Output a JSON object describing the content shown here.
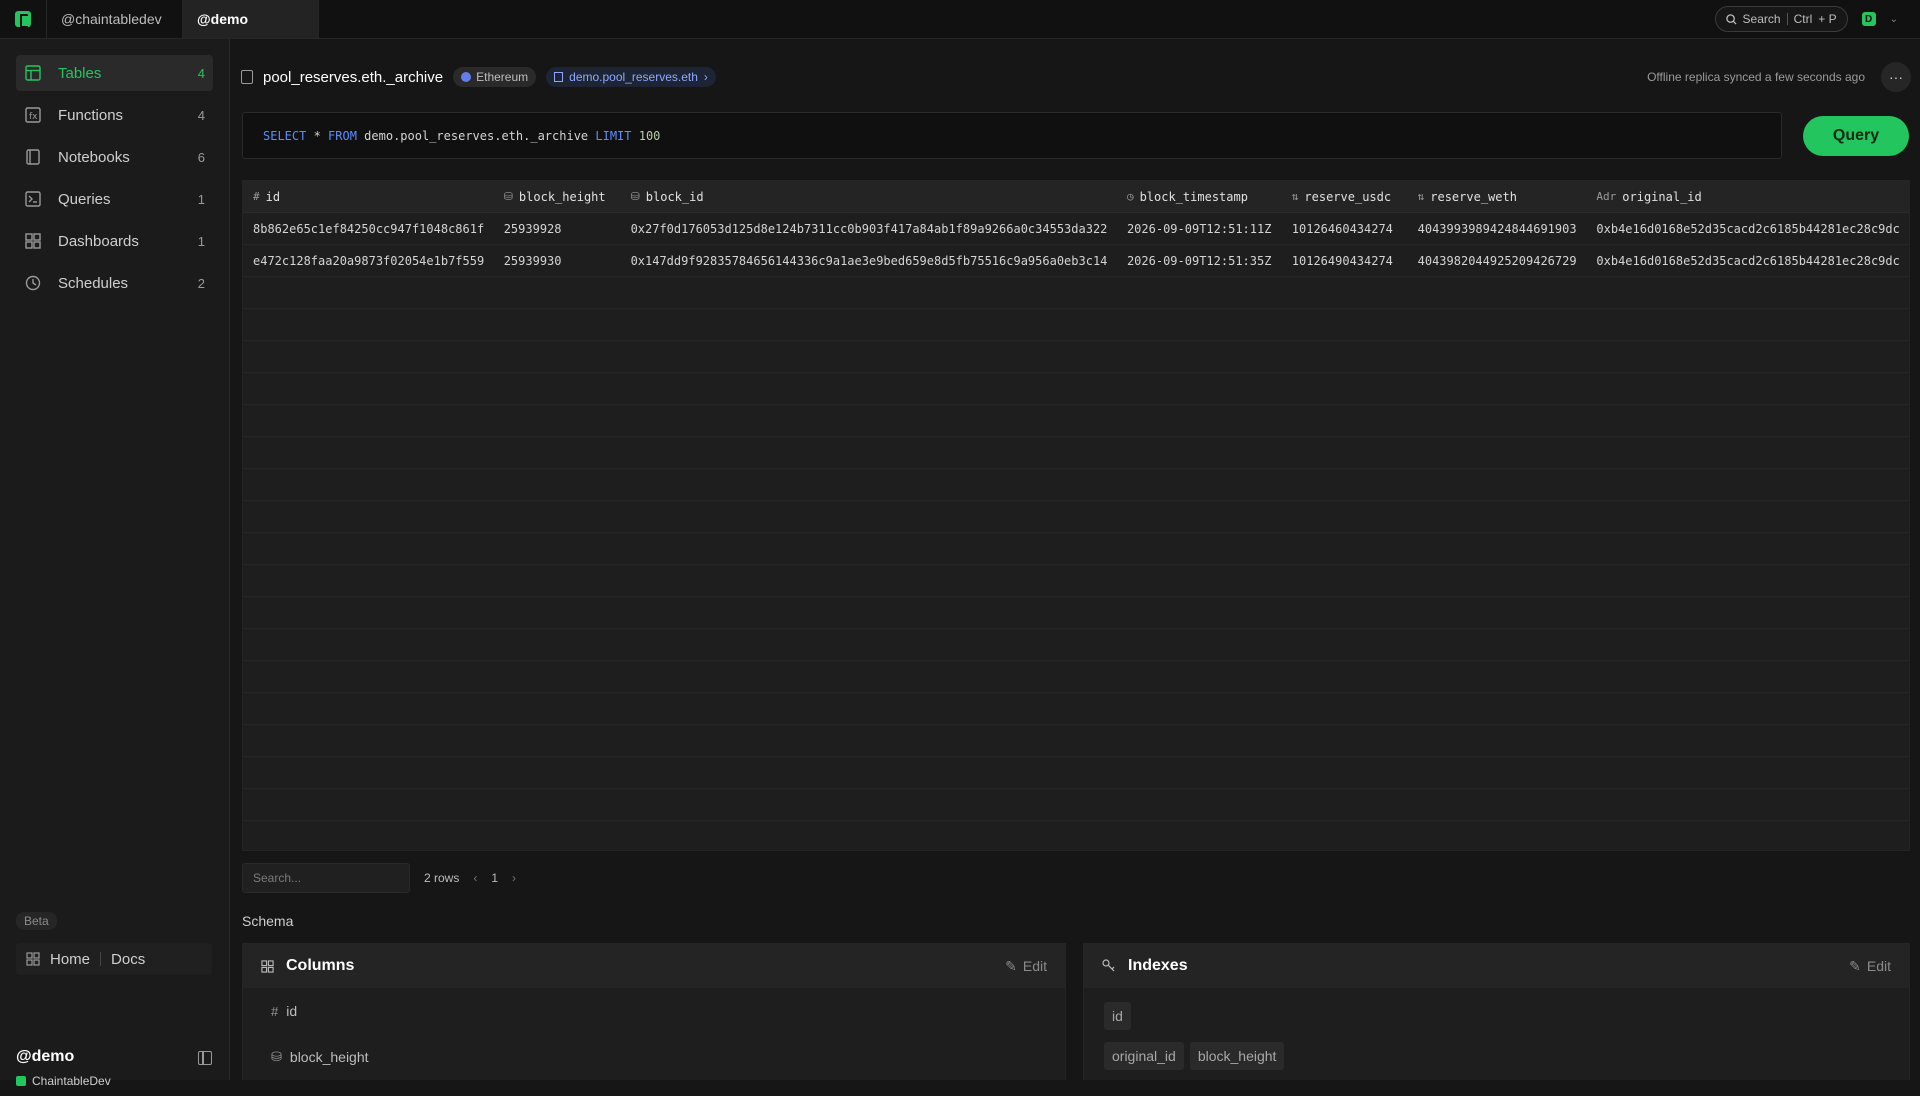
{
  "topbar": {
    "tabs": [
      {
        "label": "@chaintabledev"
      },
      {
        "label": "@demo"
      }
    ],
    "search_label": "Search",
    "shortcut_ctrl": "Ctrl",
    "shortcut_key": "+ P",
    "avatar_letter": "D"
  },
  "sidebar": {
    "items": [
      {
        "label": "Tables",
        "count": "4",
        "icon": "table-icon"
      },
      {
        "label": "Functions",
        "count": "4",
        "icon": "function-icon"
      },
      {
        "label": "Notebooks",
        "count": "6",
        "icon": "notebook-icon"
      },
      {
        "label": "Queries",
        "count": "1",
        "icon": "terminal-icon"
      },
      {
        "label": "Dashboards",
        "count": "1",
        "icon": "dashboard-icon"
      },
      {
        "label": "Schedules",
        "count": "2",
        "icon": "clock-icon"
      }
    ],
    "beta_label": "Beta",
    "home_label": "Home",
    "docs_label": "Docs",
    "user_name": "@demo",
    "org_name": "ChaintableDev"
  },
  "header": {
    "table_name": "pool_reserves.eth._archive",
    "chain_label": "Ethereum",
    "link_label": "demo.pool_reserves.eth",
    "sync_status": "Offline replica synced a few seconds ago",
    "more_label": "···"
  },
  "query": {
    "kw_select": "SELECT",
    "star": " * ",
    "kw_from": "FROM",
    "table": " demo.pool_reserves.eth._archive ",
    "kw_limit": "LIMIT",
    "limit_value": " 100",
    "button_label": "Query"
  },
  "grid": {
    "columns": [
      {
        "name": "id",
        "icon": "#"
      },
      {
        "name": "block_height",
        "icon": "⛁"
      },
      {
        "name": "block_id",
        "icon": "⛁"
      },
      {
        "name": "block_timestamp",
        "icon": "◷"
      },
      {
        "name": "reserve_usdc",
        "icon": "⇅"
      },
      {
        "name": "reserve_weth",
        "icon": "⇅"
      },
      {
        "name": "original_id",
        "icon": "Adr"
      }
    ],
    "rows": [
      [
        "8b862e65c1ef84250cc947f1048c861f",
        "25939928",
        "0x27f0d176053d125d8e124b7311cc0b903f417a84ab1f89a9266a0c34553da322",
        "2026-09-09T12:51:11Z",
        "10126460434274",
        "4043993989424844691903",
        "0xb4e16d0168e52d35cacd2c6185b44281ec28c9dc"
      ],
      [
        "e472c128faa20a9873f02054e1b7f559",
        "25939930",
        "0x147dd9f92835784656144336c9a1ae3e9bed659e8d5fb75516c9a956a0eb3c14",
        "2026-09-09T12:51:35Z",
        "10126490434274",
        "4043982044925209426729",
        "0xb4e16d0168e52d35cacd2c6185b44281ec28c9dc"
      ]
    ],
    "search_placeholder": "Search...",
    "row_count": "2 rows",
    "prev": "‹",
    "page": "1",
    "next": "›"
  },
  "schema": {
    "title": "Schema",
    "columns_title": "Columns",
    "indexes_title": "Indexes",
    "edit_label": "Edit",
    "columns": [
      {
        "name": "id",
        "icon": "#"
      },
      {
        "name": "block_height",
        "icon": "⛁"
      }
    ],
    "indexes": [
      [
        "id"
      ],
      [
        "original_id",
        "block_height"
      ]
    ]
  }
}
